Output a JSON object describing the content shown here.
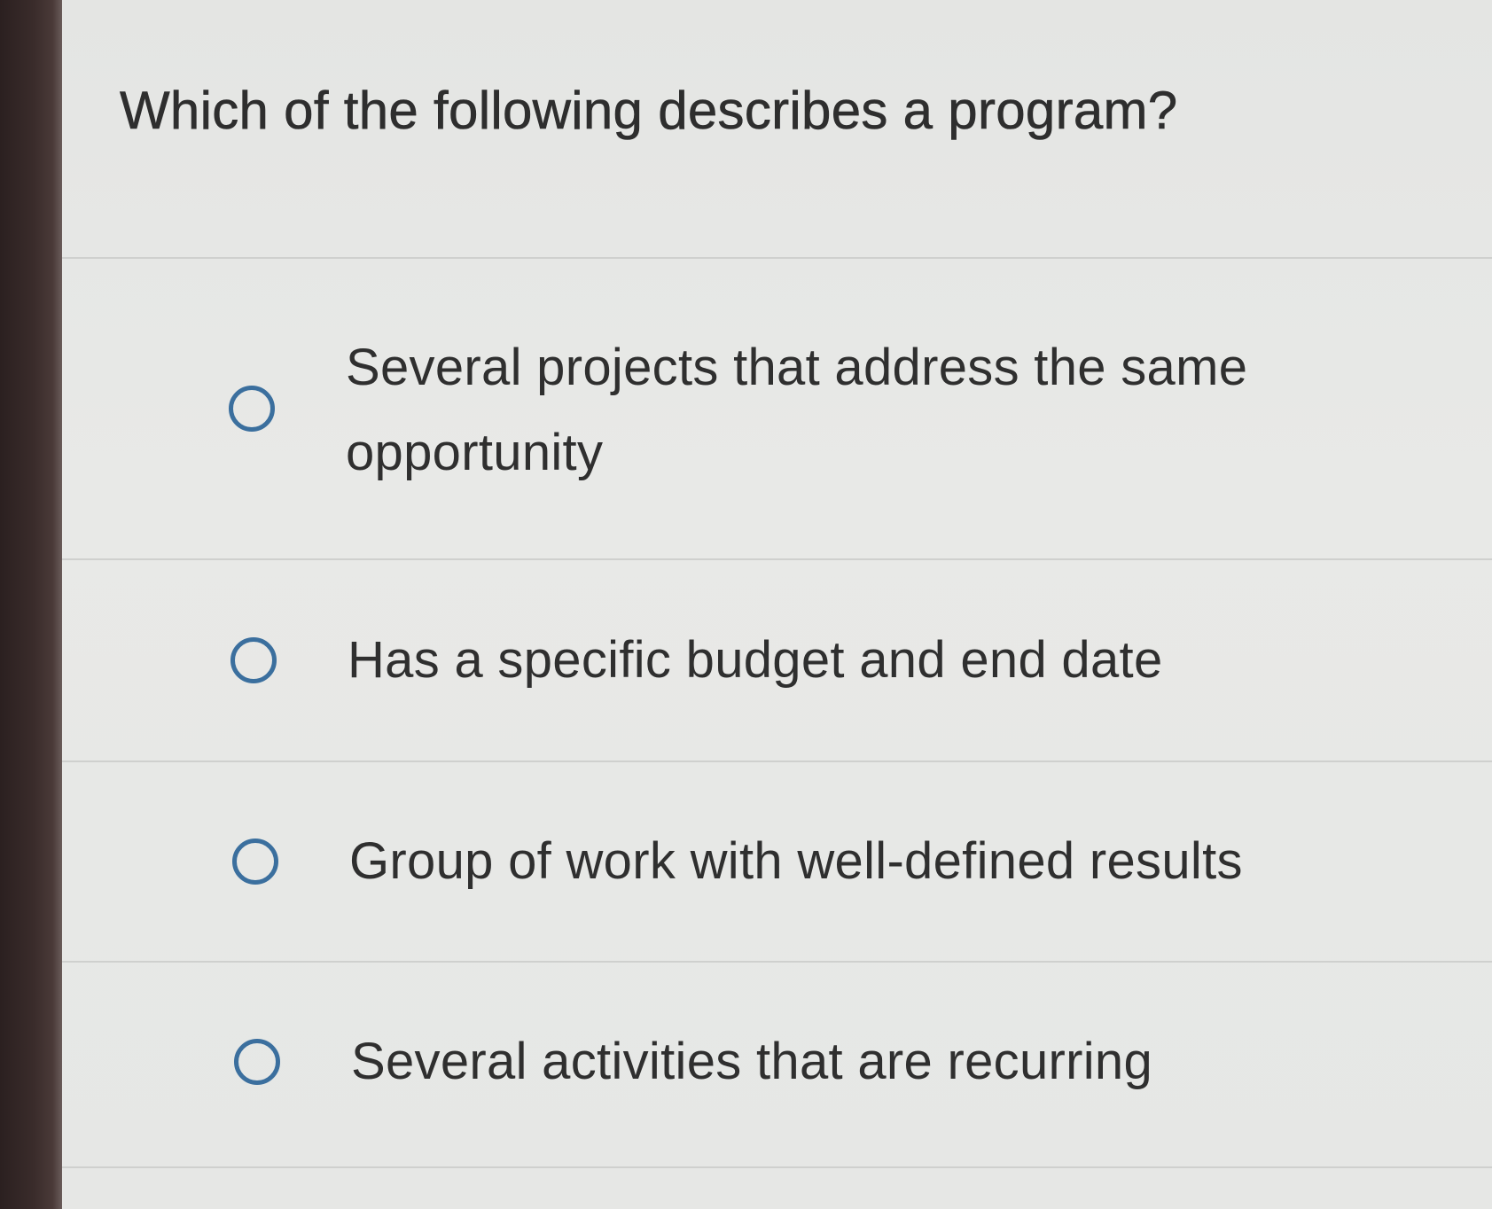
{
  "question": {
    "text": "Which of the following describes a program?"
  },
  "options": [
    {
      "label": "Several projects that address the same opportunity",
      "selected": false
    },
    {
      "label": "Has a specific budget and end date",
      "selected": false
    },
    {
      "label": "Group of work with well-defined results",
      "selected": false
    },
    {
      "label": "Several activities that are recurring",
      "selected": false
    }
  ],
  "colors": {
    "radio_border": "#3b6f9e",
    "text": "#2f2f2f",
    "background": "#e6e7e5"
  }
}
